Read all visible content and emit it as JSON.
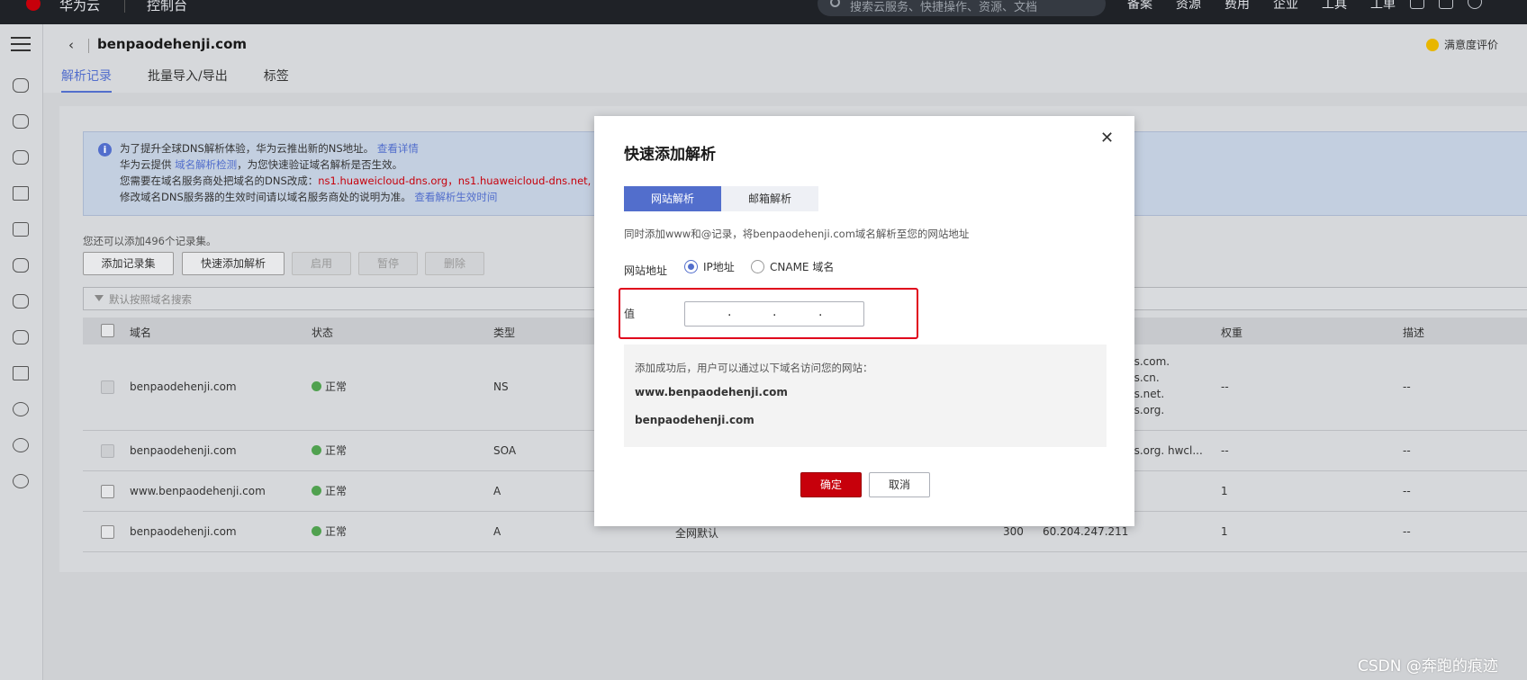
{
  "topbar": {
    "brand": "华为云",
    "logo_text": "HUAWEI",
    "console": "控制台",
    "search_placeholder": "搜索云服务、快捷操作、资源、文档",
    "nav": [
      "备案",
      "资源",
      "费用",
      "企业",
      "工具",
      "工单"
    ]
  },
  "header": {
    "back_icon": "chevron-left-icon",
    "domain": "benpaodehenji.com",
    "tabs": [
      "解析记录",
      "批量导入/导出",
      "标签"
    ],
    "satisfaction": "满意度评价"
  },
  "notice": {
    "line1": "为了提升全球DNS解析体验，华为云推出新的NS地址。",
    "line1_link": "查看详情",
    "line2_pre": "华为云提供",
    "line2_link": "域名解析检测",
    "line2_post": "，为您快速验证域名解析是否生效。",
    "line3_pre": "您需要在域名服务商处把域名的DNS改成：",
    "line3_red": "ns1.huaweicloud-dns.org，ns1.huaweicloud-dns.net, ns",
    "line4_pre": "修改域名DNS服务器的生效时间请以域名服务商处的说明为准。",
    "line4_link": "查看解析生效时间"
  },
  "toolbar": {
    "count_text": "您还可以添加496个记录集。",
    "add_record": "添加记录集",
    "quick_add": "快速添加解析",
    "enable": "启用",
    "pause": "暂停",
    "delete": "删除",
    "filter_placeholder": "默认按照域名搜索"
  },
  "table": {
    "columns": [
      "域名",
      "状态",
      "类型",
      "权重",
      "描述"
    ],
    "rows": [
      {
        "domain": "benpaodehenji.com",
        "status": "正常",
        "type": "NS",
        "value": [
          "ns.com.",
          "ns.cn.",
          "ns.net.",
          "ns.org."
        ],
        "weight": "--",
        "desc": "--"
      },
      {
        "domain": "benpaodehenji.com",
        "status": "正常",
        "type": "SOA",
        "value": [
          "ns.org. hwcl..."
        ],
        "weight": "--",
        "desc": "--"
      },
      {
        "domain": "www.benpaodehenji.com",
        "status": "正常",
        "type": "A",
        "value": [
          ""
        ],
        "weight": "1",
        "desc": "--"
      },
      {
        "domain": "benpaodehenji.com",
        "status": "正常",
        "type": "A",
        "line": "全网默认",
        "ttl": "300",
        "value": [
          "60.204.247.211"
        ],
        "weight": "1",
        "desc": "--"
      }
    ]
  },
  "modal": {
    "title": "快速添加解析",
    "tabs": [
      "网站解析",
      "邮箱解析"
    ],
    "desc": "同时添加www和@记录，将benpaodehenji.com域名解析至您的网站地址",
    "address_label": "网站地址",
    "radio_ip": "IP地址",
    "radio_cname": "CNAME 域名",
    "value_label": "值",
    "ip_separator": ".",
    "info_title": "添加成功后，用户可以通过以下域名访问您的网站：",
    "domain1": "www.benpaodehenji.com",
    "domain2": "benpaodehenji.com",
    "ok": "确定",
    "cancel": "取消"
  },
  "watermark": "CSDN @奔跑的痕迹",
  "colors": {
    "accent": "#526ecc",
    "danger": "#c7000b",
    "topbar": "#1f2227"
  }
}
